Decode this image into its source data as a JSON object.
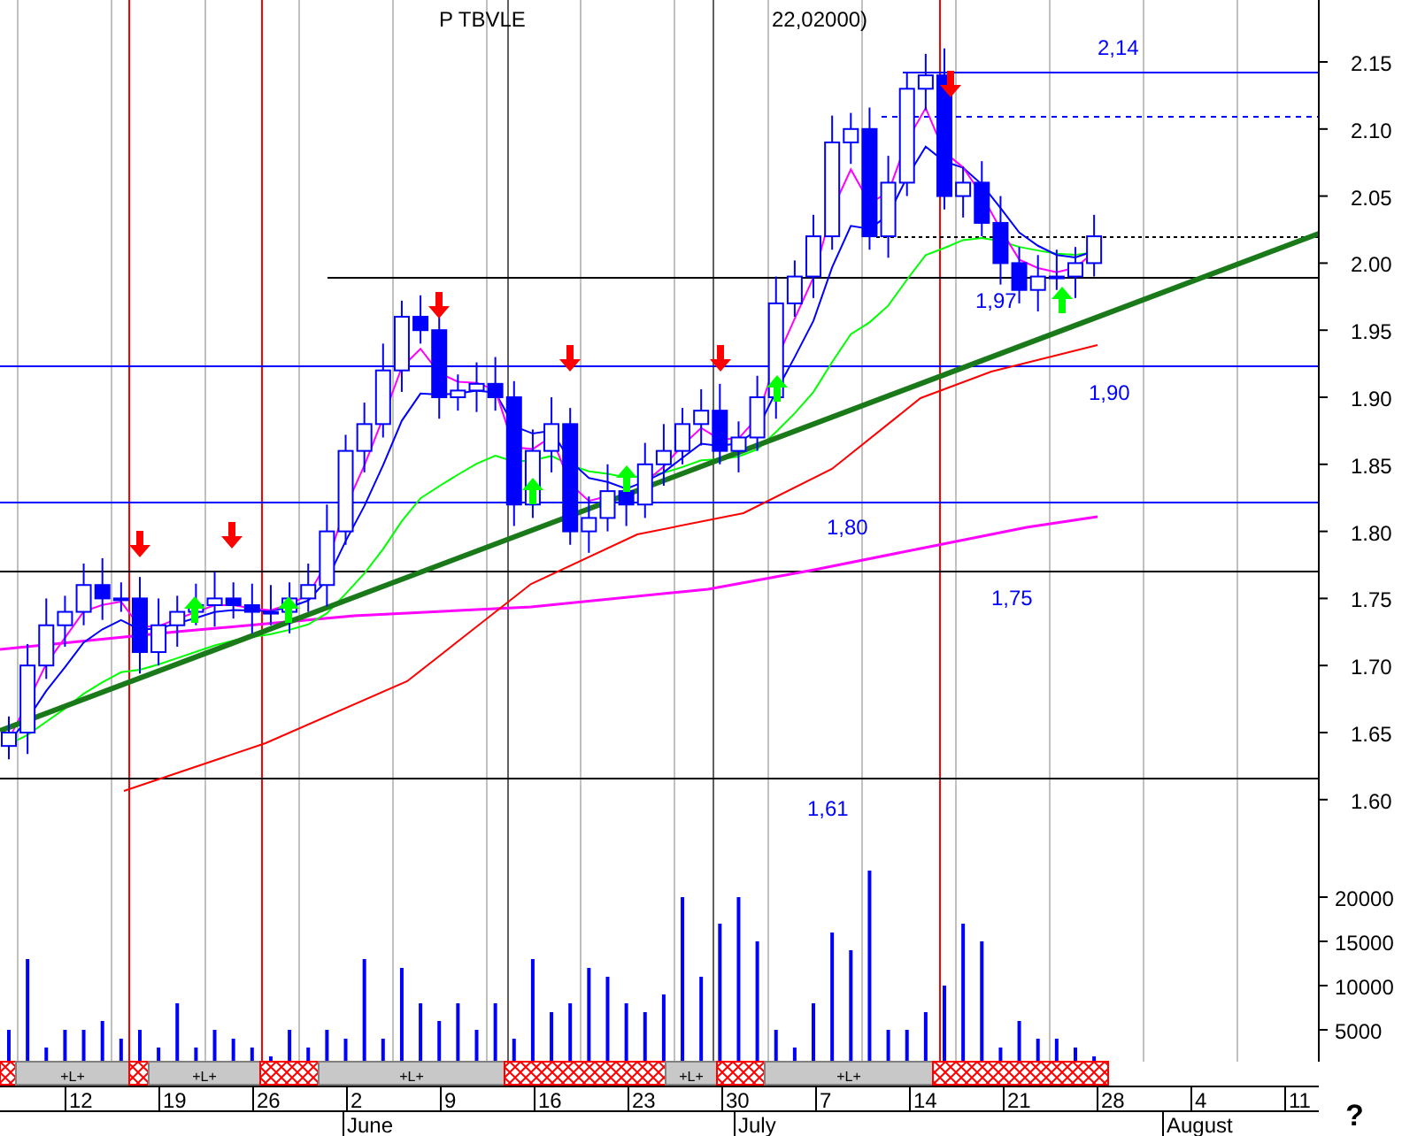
{
  "title": [
    "P TBVLE",
    "22,02000)"
  ],
  "price_axis": [
    "2.15",
    "2.10",
    "2.05",
    "2.00",
    "1.95",
    "1.90",
    "1.85",
    "1.80",
    "1.75",
    "1.70",
    "1.65",
    "1.60"
  ],
  "volume_axis": [
    "20000",
    "15000",
    "10000",
    "5000"
  ],
  "level_labels": [
    "2,14",
    "1,97",
    "1,90",
    "1,80",
    "1,75",
    "1,61"
  ],
  "segments": [
    {
      "kind": "hatched"
    },
    {
      "kind": "gray",
      "label": "+L+"
    },
    {
      "kind": "hatched"
    },
    {
      "kind": "gray",
      "label": "+L+"
    },
    {
      "kind": "hatched"
    },
    {
      "kind": "gray",
      "label": "+L+"
    },
    {
      "kind": "hatched"
    },
    {
      "kind": "gray",
      "label": "+L+"
    },
    {
      "kind": "hatched"
    },
    {
      "kind": "gray",
      "label": "+L+"
    },
    {
      "kind": "hatched"
    }
  ],
  "days": [
    "12",
    "19",
    "26",
    "2",
    "9",
    "16",
    "23",
    "30",
    "7",
    "14",
    "21",
    "28",
    "4",
    "11"
  ],
  "months": [
    "June",
    "July",
    "August"
  ],
  "help": "?"
}
